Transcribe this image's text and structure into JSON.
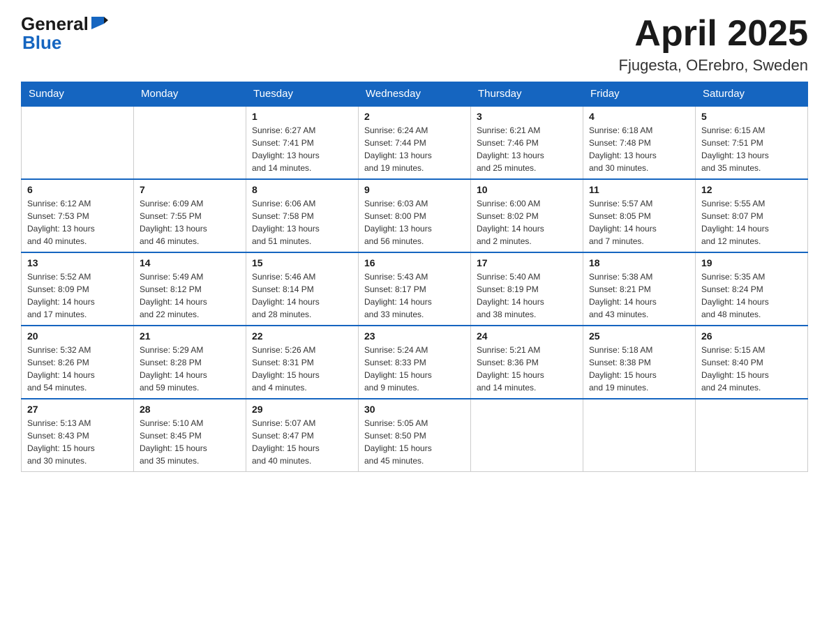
{
  "header": {
    "logo_general": "General",
    "logo_blue": "Blue",
    "title": "April 2025",
    "location": "Fjugesta, OErebro, Sweden"
  },
  "calendar": {
    "weekdays": [
      "Sunday",
      "Monday",
      "Tuesday",
      "Wednesday",
      "Thursday",
      "Friday",
      "Saturday"
    ],
    "weeks": [
      [
        {
          "day": "",
          "info": ""
        },
        {
          "day": "",
          "info": ""
        },
        {
          "day": "1",
          "info": "Sunrise: 6:27 AM\nSunset: 7:41 PM\nDaylight: 13 hours\nand 14 minutes."
        },
        {
          "day": "2",
          "info": "Sunrise: 6:24 AM\nSunset: 7:44 PM\nDaylight: 13 hours\nand 19 minutes."
        },
        {
          "day": "3",
          "info": "Sunrise: 6:21 AM\nSunset: 7:46 PM\nDaylight: 13 hours\nand 25 minutes."
        },
        {
          "day": "4",
          "info": "Sunrise: 6:18 AM\nSunset: 7:48 PM\nDaylight: 13 hours\nand 30 minutes."
        },
        {
          "day": "5",
          "info": "Sunrise: 6:15 AM\nSunset: 7:51 PM\nDaylight: 13 hours\nand 35 minutes."
        }
      ],
      [
        {
          "day": "6",
          "info": "Sunrise: 6:12 AM\nSunset: 7:53 PM\nDaylight: 13 hours\nand 40 minutes."
        },
        {
          "day": "7",
          "info": "Sunrise: 6:09 AM\nSunset: 7:55 PM\nDaylight: 13 hours\nand 46 minutes."
        },
        {
          "day": "8",
          "info": "Sunrise: 6:06 AM\nSunset: 7:58 PM\nDaylight: 13 hours\nand 51 minutes."
        },
        {
          "day": "9",
          "info": "Sunrise: 6:03 AM\nSunset: 8:00 PM\nDaylight: 13 hours\nand 56 minutes."
        },
        {
          "day": "10",
          "info": "Sunrise: 6:00 AM\nSunset: 8:02 PM\nDaylight: 14 hours\nand 2 minutes."
        },
        {
          "day": "11",
          "info": "Sunrise: 5:57 AM\nSunset: 8:05 PM\nDaylight: 14 hours\nand 7 minutes."
        },
        {
          "day": "12",
          "info": "Sunrise: 5:55 AM\nSunset: 8:07 PM\nDaylight: 14 hours\nand 12 minutes."
        }
      ],
      [
        {
          "day": "13",
          "info": "Sunrise: 5:52 AM\nSunset: 8:09 PM\nDaylight: 14 hours\nand 17 minutes."
        },
        {
          "day": "14",
          "info": "Sunrise: 5:49 AM\nSunset: 8:12 PM\nDaylight: 14 hours\nand 22 minutes."
        },
        {
          "day": "15",
          "info": "Sunrise: 5:46 AM\nSunset: 8:14 PM\nDaylight: 14 hours\nand 28 minutes."
        },
        {
          "day": "16",
          "info": "Sunrise: 5:43 AM\nSunset: 8:17 PM\nDaylight: 14 hours\nand 33 minutes."
        },
        {
          "day": "17",
          "info": "Sunrise: 5:40 AM\nSunset: 8:19 PM\nDaylight: 14 hours\nand 38 minutes."
        },
        {
          "day": "18",
          "info": "Sunrise: 5:38 AM\nSunset: 8:21 PM\nDaylight: 14 hours\nand 43 minutes."
        },
        {
          "day": "19",
          "info": "Sunrise: 5:35 AM\nSunset: 8:24 PM\nDaylight: 14 hours\nand 48 minutes."
        }
      ],
      [
        {
          "day": "20",
          "info": "Sunrise: 5:32 AM\nSunset: 8:26 PM\nDaylight: 14 hours\nand 54 minutes."
        },
        {
          "day": "21",
          "info": "Sunrise: 5:29 AM\nSunset: 8:28 PM\nDaylight: 14 hours\nand 59 minutes."
        },
        {
          "day": "22",
          "info": "Sunrise: 5:26 AM\nSunset: 8:31 PM\nDaylight: 15 hours\nand 4 minutes."
        },
        {
          "day": "23",
          "info": "Sunrise: 5:24 AM\nSunset: 8:33 PM\nDaylight: 15 hours\nand 9 minutes."
        },
        {
          "day": "24",
          "info": "Sunrise: 5:21 AM\nSunset: 8:36 PM\nDaylight: 15 hours\nand 14 minutes."
        },
        {
          "day": "25",
          "info": "Sunrise: 5:18 AM\nSunset: 8:38 PM\nDaylight: 15 hours\nand 19 minutes."
        },
        {
          "day": "26",
          "info": "Sunrise: 5:15 AM\nSunset: 8:40 PM\nDaylight: 15 hours\nand 24 minutes."
        }
      ],
      [
        {
          "day": "27",
          "info": "Sunrise: 5:13 AM\nSunset: 8:43 PM\nDaylight: 15 hours\nand 30 minutes."
        },
        {
          "day": "28",
          "info": "Sunrise: 5:10 AM\nSunset: 8:45 PM\nDaylight: 15 hours\nand 35 minutes."
        },
        {
          "day": "29",
          "info": "Sunrise: 5:07 AM\nSunset: 8:47 PM\nDaylight: 15 hours\nand 40 minutes."
        },
        {
          "day": "30",
          "info": "Sunrise: 5:05 AM\nSunset: 8:50 PM\nDaylight: 15 hours\nand 45 minutes."
        },
        {
          "day": "",
          "info": ""
        },
        {
          "day": "",
          "info": ""
        },
        {
          "day": "",
          "info": ""
        }
      ]
    ]
  }
}
